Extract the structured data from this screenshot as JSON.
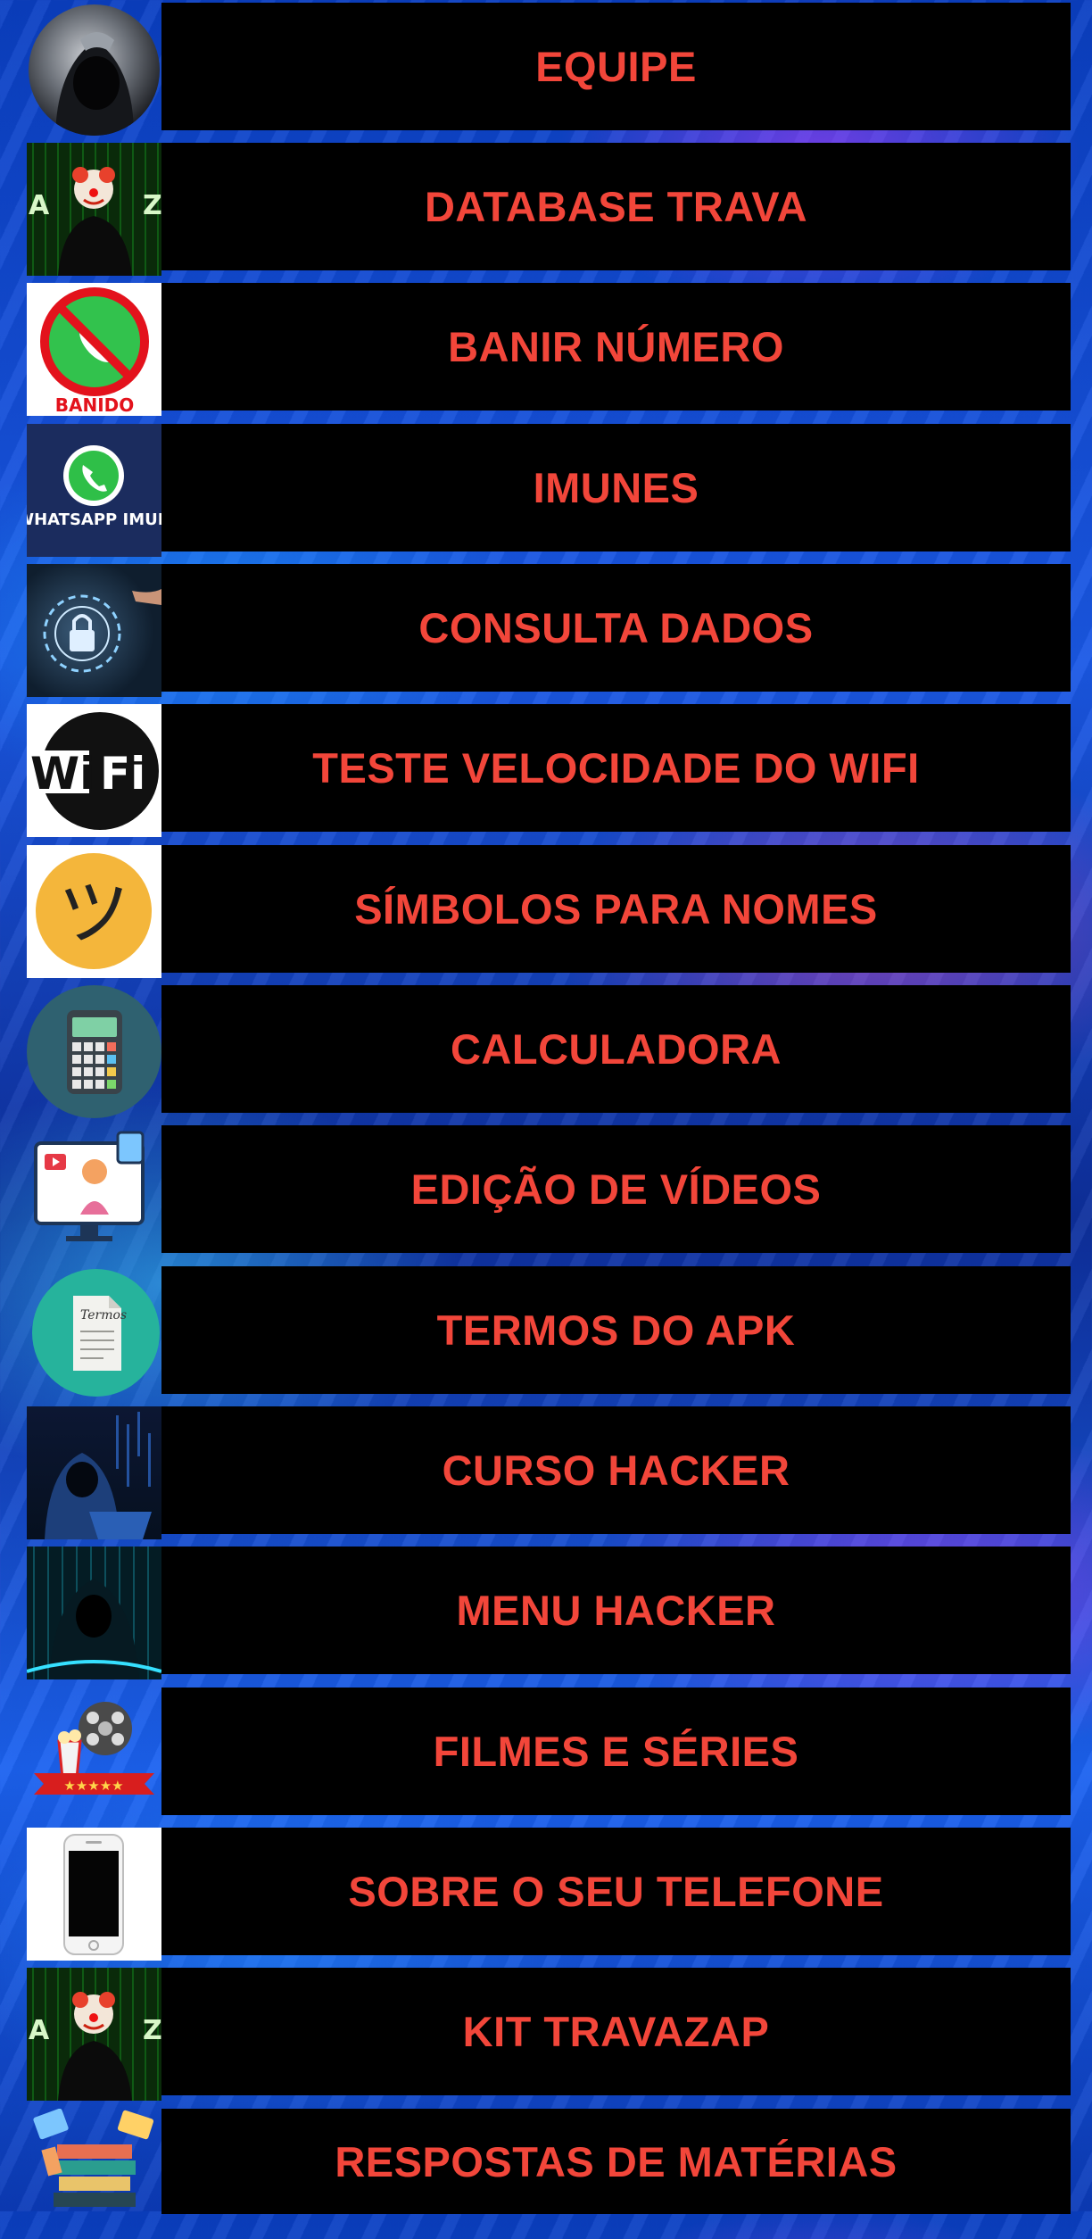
{
  "menu": {
    "items": [
      {
        "label": "EQUIPE",
        "icon": "hooded-figure-icon"
      },
      {
        "label": "DATABASE TRAVA",
        "icon": "clown-hacker-icon"
      },
      {
        "label": "BANIR NÚMERO",
        "icon": "banned-whatsapp-icon",
        "icon_text": "BANIDO"
      },
      {
        "label": "IMUNES",
        "icon": "whatsapp-immune-icon",
        "icon_text": "WHATSAPP IMUN"
      },
      {
        "label": "CONSULTA DADOS",
        "icon": "data-lock-icon"
      },
      {
        "label": "TESTE VELOCIDADE DO WIFI",
        "icon": "wifi-logo-icon",
        "icon_text": "Wi Fi"
      },
      {
        "label": "SÍMBOLOS PARA NOMES",
        "icon": "smiley-symbol-icon",
        "icon_text": "ツ"
      },
      {
        "label": "CALCULADORA",
        "icon": "calculator-icon"
      },
      {
        "label": "EDIÇÃO DE VÍDEOS",
        "icon": "video-editing-icon"
      },
      {
        "label": "TERMOS DO APK",
        "icon": "terms-document-icon",
        "icon_text": "Termos"
      },
      {
        "label": "CURSO HACKER",
        "icon": "hacker-laptop-icon"
      },
      {
        "label": "MENU HACKER",
        "icon": "hacker-matrix-icon"
      },
      {
        "label": "FILMES E SÉRIES",
        "icon": "film-reel-icon",
        "icon_text": "★★★★★"
      },
      {
        "label": "SOBRE O SEU TELEFONE",
        "icon": "smartphone-icon"
      },
      {
        "label": "KIT TRAVAZAP",
        "icon": "clown-hacker-icon"
      },
      {
        "label": "RESPOSTAS DE MATÉRIAS",
        "icon": "books-stack-icon"
      }
    ]
  },
  "colors": {
    "button_bg": "#000000",
    "button_text": "#f2463a",
    "background": "#1a58e6"
  }
}
